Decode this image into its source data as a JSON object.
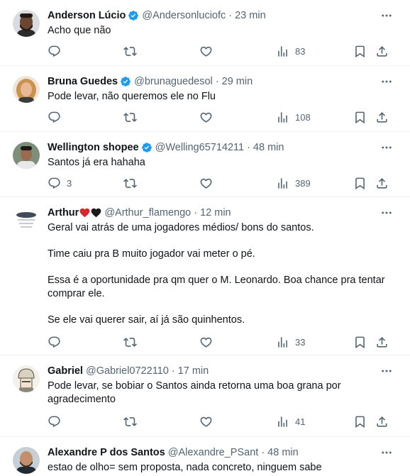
{
  "tweets": [
    {
      "name": "Anderson Lúcio",
      "verified": true,
      "emoji": "",
      "handle": "@Andersonluciofc",
      "time": "23 min",
      "text": [
        "Acho que não"
      ],
      "replies": "",
      "retweets": "",
      "likes": "",
      "views": "83"
    },
    {
      "name": "Bruna Guedes",
      "verified": true,
      "emoji": "",
      "handle": "@brunaguedesol",
      "time": "29 min",
      "text": [
        "Pode levar, não queremos ele no Flu"
      ],
      "replies": "",
      "retweets": "",
      "likes": "",
      "views": "108"
    },
    {
      "name": "Wellington shopee",
      "verified": true,
      "emoji": "",
      "handle": "@Welling65714211",
      "time": "48 min",
      "text": [
        "Santos já era hahaha"
      ],
      "replies": "3",
      "retweets": "",
      "likes": "",
      "views": "389"
    },
    {
      "name": "Arthur",
      "verified": false,
      "emoji": "red-heart black-heart",
      "handle": "@Arthur_flamengo",
      "time": "12 min",
      "text": [
        "Geral vai atrás de uma jogadores médios/ bons do santos.",
        "Time caiu pra B muito jogador vai meter o pé.",
        "Essa é a oportunidade pra qm quer o M. Leonardo. Boa chance pra tentar comprar ele.",
        "Se ele vai querer sair, aí já são quinhentos."
      ],
      "replies": "",
      "retweets": "",
      "likes": "",
      "views": "33"
    },
    {
      "name": "Gabriel",
      "verified": false,
      "emoji": "",
      "handle": "@Gabriel0722110",
      "time": "17 min",
      "text": [
        "Pode levar, se bobiar o Santos ainda retorna uma boa grana por agradecimento"
      ],
      "replies": "",
      "retweets": "",
      "likes": "",
      "views": "41"
    },
    {
      "name": "Alexandre P dos Santos",
      "verified": false,
      "emoji": "",
      "handle": "@Alexandre_PSant",
      "time": "48 min",
      "text": [
        "estao de olho= sem proposta, nada concreto, ninguem sabe"
      ],
      "replies": "",
      "retweets": "",
      "likes": "",
      "views": ""
    }
  ],
  "separator": "·",
  "icons": {
    "reply": "reply-icon",
    "retweet": "retweet-icon",
    "like": "like-icon",
    "views": "views-icon",
    "bookmark": "bookmark-icon",
    "share": "share-icon",
    "more": "more-icon",
    "verified": "verified-badge-icon"
  },
  "colors": {
    "text": "#0f1419",
    "muted": "#536471",
    "verified": "#1d9bf0",
    "divider": "#eff3f4"
  }
}
